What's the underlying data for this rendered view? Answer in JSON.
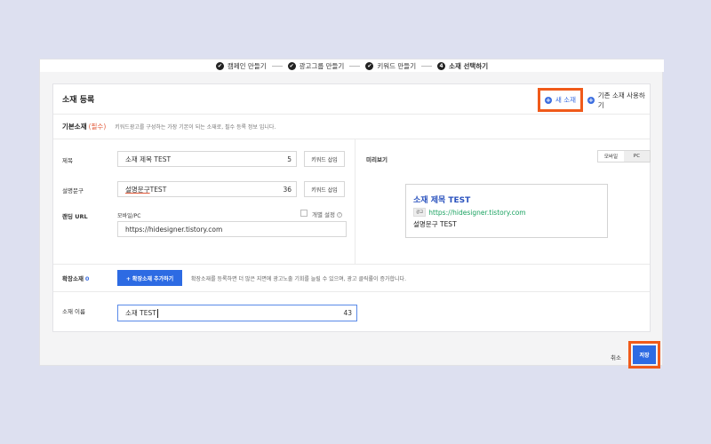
{
  "stepper": {
    "steps": [
      {
        "label": "캠페인 만들기",
        "marker": "✔"
      },
      {
        "label": "광고그룹 만들기",
        "marker": "✔"
      },
      {
        "label": "키워드 만들기",
        "marker": "✔"
      },
      {
        "label": "소재 선택하기",
        "marker": "4"
      }
    ]
  },
  "header": {
    "title": "소재 등록",
    "new_material": "새 소재",
    "existing_material": "기존 소재 사용하기",
    "plus": "+"
  },
  "basic": {
    "label": "기본소재",
    "required": "(필수)",
    "description": "키워드광고를 구성하는 가장 기본이 되는 소재로, 필수 등록 정보 입니다."
  },
  "form": {
    "title_label": "제목",
    "title_value": "소재 제목 TEST",
    "title_count": "5",
    "desc_label": "설명문구",
    "desc_value_underlined": "설명문구",
    "desc_value_rest": " TEST",
    "desc_count": "36",
    "keyword_insert": "키워드 삽입",
    "landing_label": "랜딩 URL",
    "mobile_pc_label": "모바일/PC",
    "individual_setting": "개별 설정",
    "help": "?",
    "landing_value": "https://hidesigner.tistory.com"
  },
  "preview": {
    "label": "미리보기",
    "toggle_mobile": "모바일",
    "toggle_pc": "PC",
    "ad_title": "소재 제목 TEST",
    "ad_badge": "광고",
    "ad_url": "https://hidesigner.tistory.com",
    "ad_desc": "설명문구 TEST"
  },
  "extension": {
    "label": "확장소재",
    "count": "0",
    "button": "+ 확장소재 추가하기",
    "description": "확장소재를 등록하면 더 많은 지면에 광고노출 기회를 늘릴 수 있으며, 광고 클릭률이 증가합니다."
  },
  "name": {
    "label": "소재 이름",
    "value": "소재 TEST",
    "count": "43"
  },
  "footer": {
    "cancel": "취소",
    "save": "저장"
  },
  "colors": {
    "accent": "#2d6be3",
    "highlight": "#f05a1a",
    "url_green": "#1aa260"
  }
}
